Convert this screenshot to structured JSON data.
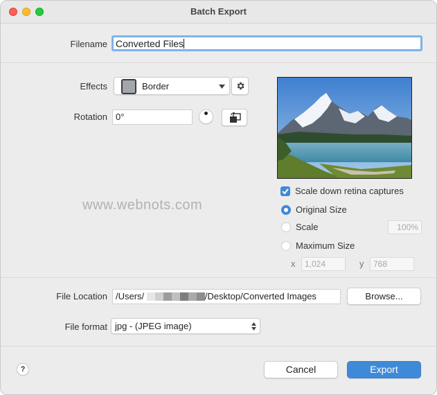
{
  "window": {
    "title": "Batch Export"
  },
  "filename": {
    "label": "Filename",
    "value": "Converted Files"
  },
  "effects": {
    "label": "Effects",
    "selected": "Border"
  },
  "rotation": {
    "label": "Rotation",
    "value": "0°"
  },
  "options": {
    "scale_retina_label": "Scale down retina captures",
    "scale_retina_checked": true,
    "original_size_label": "Original Size",
    "scale_label": "Scale",
    "scale_value": "100%",
    "maximum_size_label": "Maximum Size",
    "x_label": "x",
    "x_value": "1,024",
    "y_label": "y",
    "y_value": "768",
    "selected_option": "Original Size"
  },
  "watermark": "www.webnots.com",
  "file_location": {
    "label": "File Location",
    "path_prefix": "/Users/",
    "path_suffix": "/Desktop/Converted Images",
    "browse_label": "Browse..."
  },
  "file_format": {
    "label": "File format",
    "selected": "jpg - (JPEG image)"
  },
  "footer": {
    "help_label": "?",
    "cancel_label": "Cancel",
    "export_label": "Export"
  },
  "colors": {
    "accent": "#3f8ad8",
    "focus_ring": "#7fb1ee"
  },
  "icons": {
    "effects_settings": "gear-icon",
    "rotate": "rotate-icon",
    "effects_dropdown": "chevron-down-icon",
    "format_dropdown": "up-down-chevron-icon",
    "checkbox": "checkmark-icon"
  }
}
